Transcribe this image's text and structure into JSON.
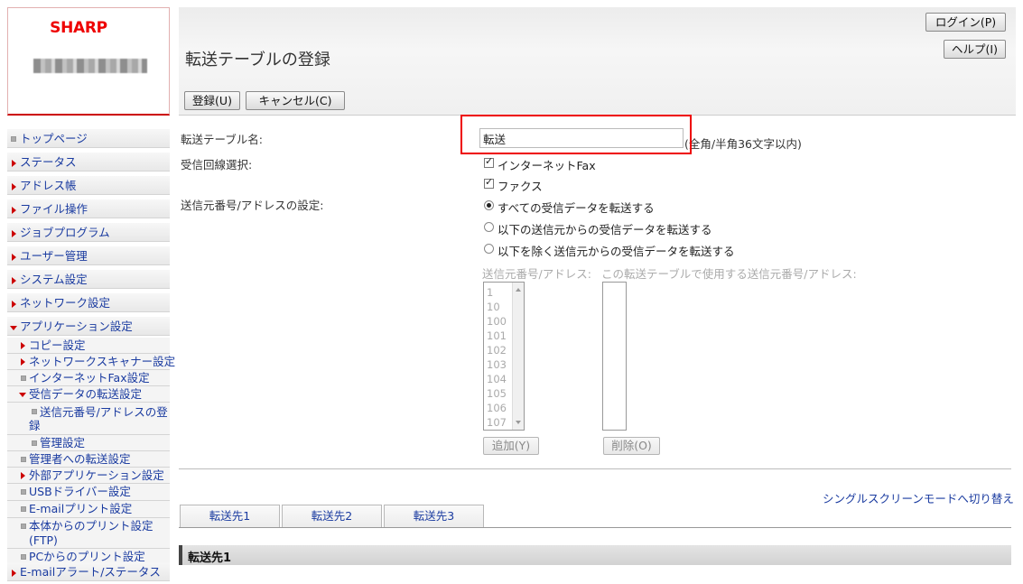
{
  "brand": {
    "logo": "SHARP"
  },
  "header": {
    "title": "転送テーブルの登録",
    "login_label": "ログイン(P)",
    "help_label": "ヘルプ(I)",
    "register_label": "登録(U)",
    "cancel_label": "キャンセル(C)"
  },
  "sidebar": {
    "items": [
      {
        "label": "トップページ"
      },
      {
        "label": "ステータス"
      },
      {
        "label": "アドレス帳"
      },
      {
        "label": "ファイル操作"
      },
      {
        "label": "ジョブプログラム"
      },
      {
        "label": "ユーザー管理"
      },
      {
        "label": "システム設定"
      },
      {
        "label": "ネットワーク設定"
      },
      {
        "label": "アプリケーション設定"
      },
      {
        "label": "コピー設定"
      },
      {
        "label": "ネットワークスキャナー設定"
      },
      {
        "label": "インターネットFax設定"
      },
      {
        "label": "受信データの転送設定"
      },
      {
        "label_line1": "送信元番号/アドレスの登",
        "label_line2": "録"
      },
      {
        "label": "管理設定"
      },
      {
        "label": "管理者への転送設定"
      },
      {
        "label": "外部アプリケーション設定"
      },
      {
        "label": "USBドライバー設定"
      },
      {
        "label": "E-mailプリント設定"
      },
      {
        "label_line1": "本体からのプリント設定",
        "label_line2": "(FTP)"
      },
      {
        "label": "PCからのプリント設定"
      },
      {
        "label": "E-mailアラート/ステータス"
      }
    ]
  },
  "form": {
    "name_label": "転送テーブル名:",
    "name_value": "転送",
    "name_hint": "(全角/半角36文字以内)",
    "line_label": "受信回線選択:",
    "line_options": [
      "インターネットFax",
      "ファクス"
    ],
    "sender_label": "送信元番号/アドレスの設定:",
    "sender_options": [
      "すべての受信データを転送する",
      "以下の送信元からの受信データを転送する",
      "以下を除く送信元からの受信データを転送する"
    ],
    "list_left_label": "送信元番号/アドレス:",
    "list_right_label": "この転送テーブルで使用する送信元番号/アドレス:",
    "list_items": [
      "1",
      "10",
      "100",
      "101",
      "102",
      "103",
      "104",
      "105",
      "106",
      "107"
    ],
    "add_label": "追加(Y)",
    "delete_label": "削除(O)"
  },
  "link": {
    "single_screen": "シングルスクリーンモードへ切り替え"
  },
  "tabs": [
    "転送先1",
    "転送先2",
    "転送先3"
  ],
  "section": {
    "title": "転送先1"
  }
}
